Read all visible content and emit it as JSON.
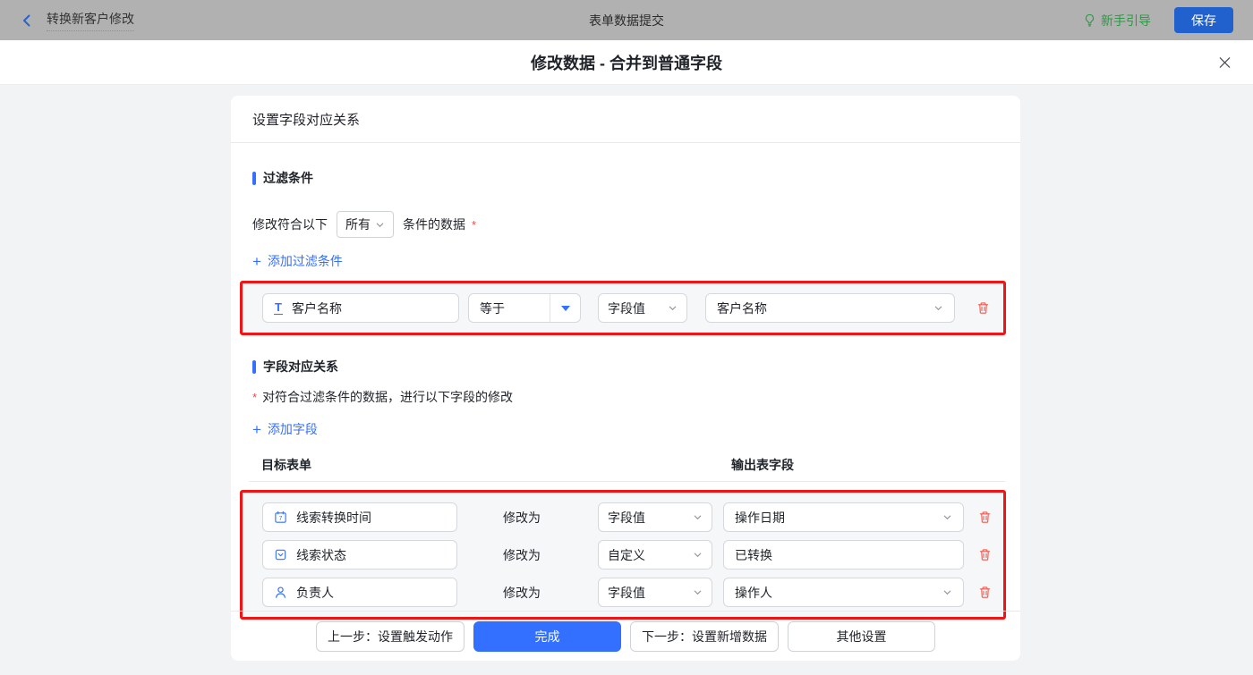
{
  "topbar": {
    "title": "转换新客户修改",
    "center_title": "表单数据提交",
    "guide_label": "新手引导",
    "save_label": "保存"
  },
  "modal": {
    "title": "修改数据 - 合并到普通字段"
  },
  "card": {
    "header": "设置字段对应关系",
    "filter": {
      "title": "过滤条件",
      "sentence_prefix": "修改符合以下",
      "match_value": "所有",
      "sentence_suffix": "条件的数据",
      "required_mark": "*",
      "add_icon": "+",
      "add_label": "添加过滤条件",
      "condition": {
        "field": "客户名称",
        "field_icon": "text-field-icon",
        "field_icon_glyph": "T",
        "operator": "等于",
        "value_type": "字段值",
        "value": "客户名称"
      }
    },
    "mapping": {
      "title": "字段对应关系",
      "required_mark": "*",
      "description": "对符合过滤条件的数据，进行以下字段的修改",
      "add_icon": "+",
      "add_label": "添加字段",
      "col_target": "目标表单",
      "col_output": "输出表字段",
      "modify_label": "修改为",
      "rows": [
        {
          "field": "线索转换时间",
          "icon": "calendar-icon",
          "type": "字段值",
          "value": "操作日期"
        },
        {
          "field": "线索状态",
          "icon": "select-field-icon",
          "type": "自定义",
          "value": "已转换"
        },
        {
          "field": "负责人",
          "icon": "person-icon",
          "type": "字段值",
          "value": "操作人"
        }
      ]
    },
    "footer": {
      "prev_label": "上一步：设置触发动作",
      "done_label": "完成",
      "next_label": "下一步：设置新增数据",
      "other_label": "其他设置"
    }
  },
  "colors": {
    "accent_blue": "#3370ff",
    "highlight_red": "#f01414",
    "danger_red": "#f54a45",
    "guide_green": "#2b9a44",
    "topbar_dim": "#b1b1b1"
  }
}
